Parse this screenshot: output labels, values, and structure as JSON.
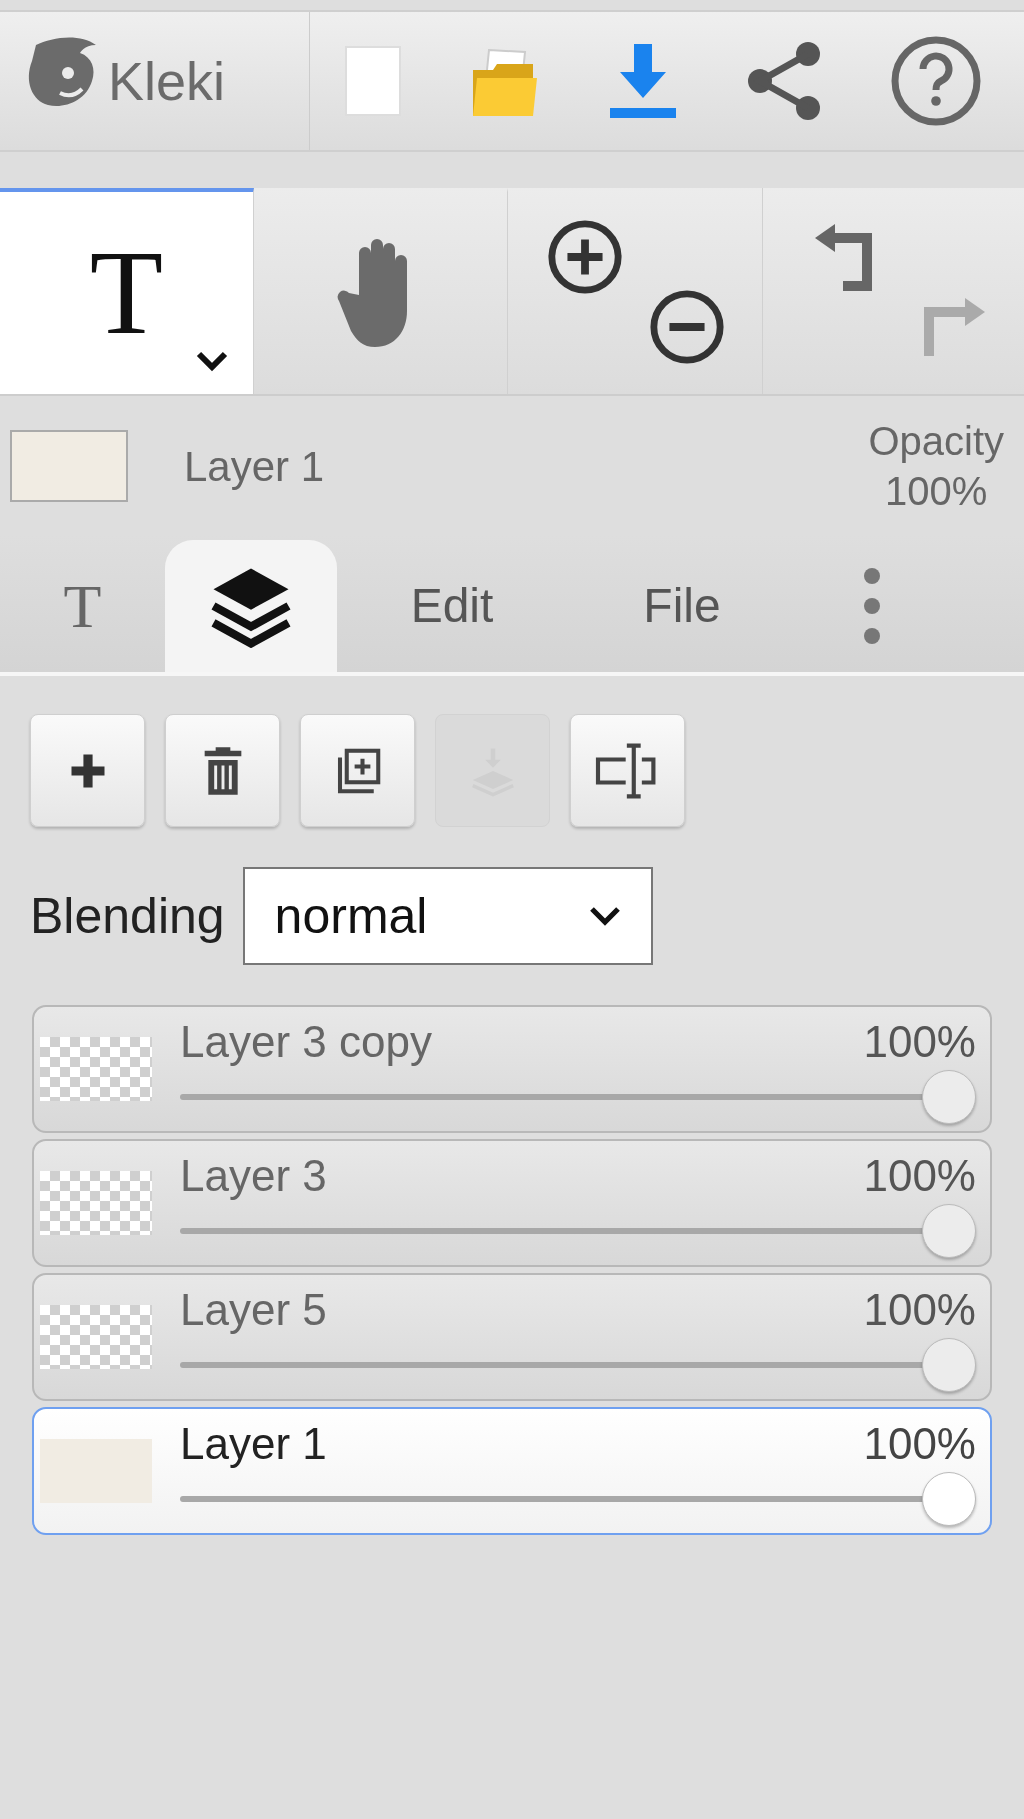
{
  "app": {
    "logo": "Kleki"
  },
  "tools": [
    {
      "kind": "text",
      "glyph": "T",
      "selected": true
    },
    {
      "kind": "hand",
      "selected": false
    }
  ],
  "history": {
    "undo_disabled": false,
    "redo_disabled": true
  },
  "current_layer": {
    "name": "Layer 1",
    "opacity_label": "Opacity",
    "opacity_value": "100%"
  },
  "tabs": [
    {
      "kind": "glyph",
      "glyph": "T",
      "selected": false
    },
    {
      "kind": "layers",
      "selected": true
    },
    {
      "kind": "label",
      "label": "Edit",
      "selected": false
    },
    {
      "kind": "label",
      "label": "File",
      "selected": false
    },
    {
      "kind": "more",
      "selected": false
    }
  ],
  "layer_buttons": [
    {
      "kind": "add",
      "disabled": false
    },
    {
      "kind": "delete",
      "disabled": false
    },
    {
      "kind": "duplicate",
      "disabled": false
    },
    {
      "kind": "merge",
      "disabled": true
    },
    {
      "kind": "rename",
      "disabled": false
    }
  ],
  "blending": {
    "label": "Blending",
    "value": "normal"
  },
  "layers": [
    {
      "name": "Layer 3 copy",
      "opacity": "100%",
      "level": 1,
      "selected": false,
      "kind": "transparent"
    },
    {
      "name": "Layer 3",
      "opacity": "100%",
      "level": 1,
      "selected": false,
      "kind": "transparent"
    },
    {
      "name": "Layer 5",
      "opacity": "100%",
      "level": 1,
      "selected": false,
      "kind": "transparent"
    },
    {
      "name": "Layer 1",
      "opacity": "100%",
      "level": 1,
      "selected": true,
      "kind": "solid"
    }
  ]
}
